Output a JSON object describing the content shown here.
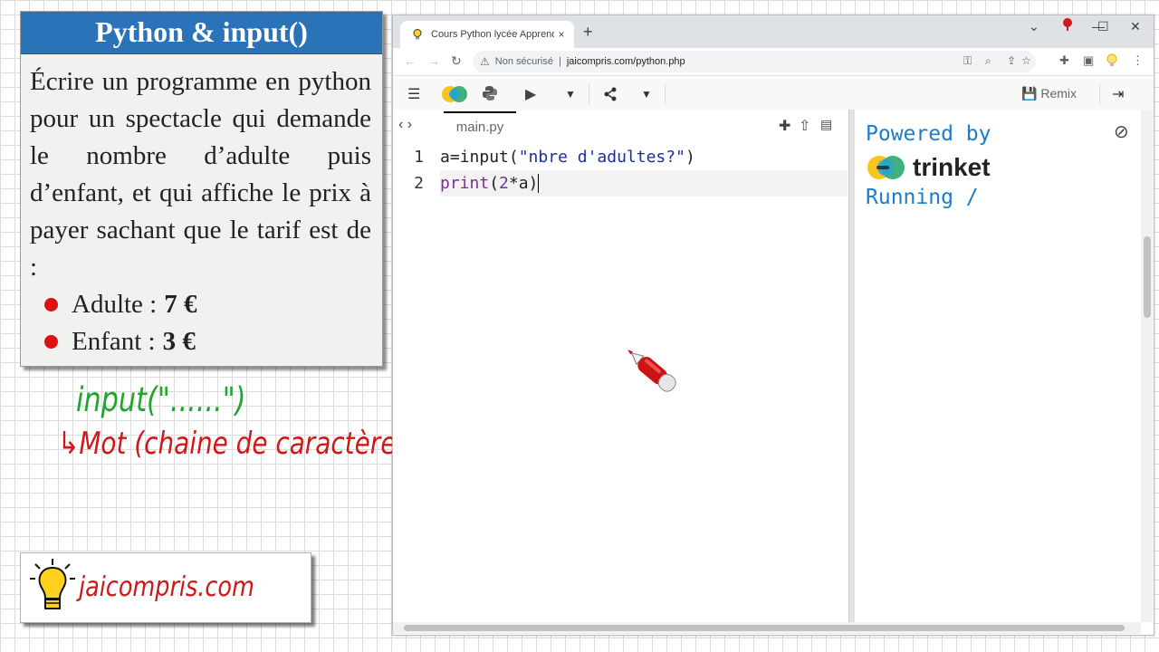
{
  "card": {
    "title": "Python & input()",
    "body": "Écrire un programme en python pour un spectacle qui demande le nombre d’adulte puis d’enfant, et qui affiche le prix à payer sachant que le tarif est de :",
    "tarifs": [
      {
        "label": "Adulte :",
        "price": "7 €"
      },
      {
        "label": "Enfant :",
        "price": "3 €"
      }
    ],
    "bullet_color": "#e01010",
    "header_color": "#2b73b9"
  },
  "notes": {
    "line1": "input(\"......\")",
    "line2": "↳Mot (chaine de caractères)"
  },
  "logo": {
    "text": "jaicompris.com"
  },
  "browser": {
    "tab_title": "Cours Python lycée Apprendre à",
    "tab_close": "×",
    "new_tab": "+",
    "security_label": "Non sécurisé",
    "url": "jaicompris.com/python.php",
    "window_buttons": [
      "⌄",
      "—",
      "☐",
      "✕"
    ]
  },
  "app": {
    "remix_label": "Remix",
    "file_tab": "main.py",
    "line_numbers": [
      "1",
      "2"
    ],
    "code": {
      "line1": {
        "var": "a=",
        "fn": "input",
        "open": "(",
        "str": "\"nbre d'adultes?\"",
        "close": ")"
      },
      "line2": {
        "fn": "print",
        "open": "(",
        "num": "2",
        "rest": "*a)"
      }
    },
    "output": {
      "powered_by": "Powered by",
      "brand": "trinket",
      "status": "Running /"
    }
  },
  "colors": {
    "accent_blue": "#1b7cc9",
    "string_blue": "#1a2fa0",
    "keyword_purple": "#7a2e96",
    "handwriting_green": "#1ea52b",
    "handwriting_red": "#d01818"
  },
  "icons": [
    "back-icon",
    "forward-icon",
    "reload-icon",
    "warning-icon",
    "key-icon",
    "zoom-icon",
    "share-icon",
    "star-icon",
    "puzzle-icon",
    "sidebar-icon",
    "bulb-icon",
    "menu-icon",
    "trinket-logo-icon",
    "python-icon",
    "play-icon",
    "dropdown-icon",
    "share-nodes-icon",
    "save-icon",
    "login-icon",
    "code-toggle-icon",
    "add-file-icon",
    "upload-icon",
    "image-file-icon",
    "stop-icon"
  ]
}
